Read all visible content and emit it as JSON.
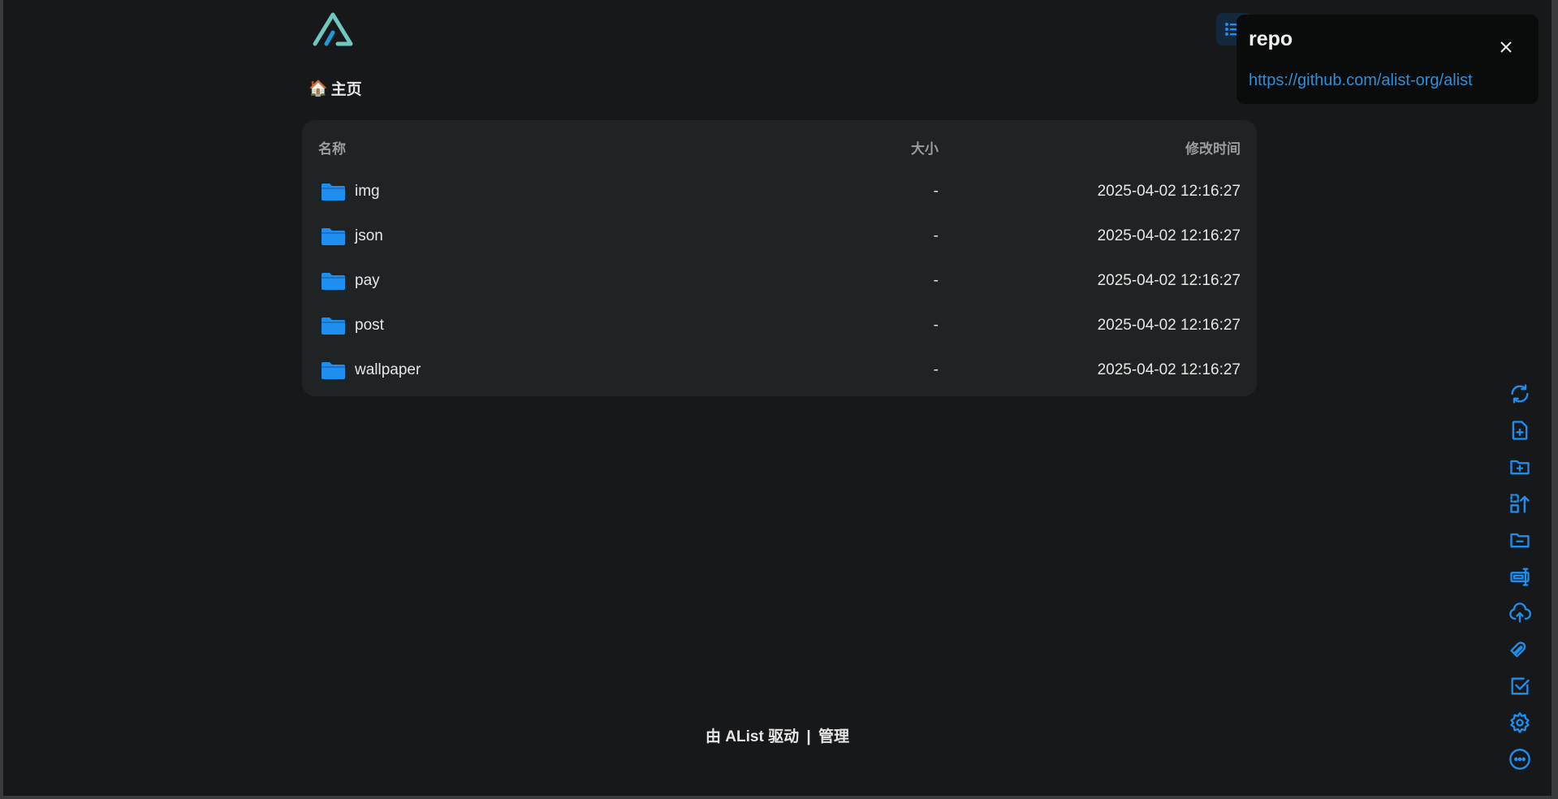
{
  "breadcrumb": {
    "icon": "🏠",
    "label": "主页"
  },
  "table": {
    "headers": {
      "name": "名称",
      "size": "大小",
      "modified": "修改时间"
    },
    "rows": [
      {
        "name": "img",
        "size": "-",
        "modified": "2025-04-02 12:16:27"
      },
      {
        "name": "json",
        "size": "-",
        "modified": "2025-04-02 12:16:27"
      },
      {
        "name": "pay",
        "size": "-",
        "modified": "2025-04-02 12:16:27"
      },
      {
        "name": "post",
        "size": "-",
        "modified": "2025-04-02 12:16:27"
      },
      {
        "name": "wallpaper",
        "size": "-",
        "modified": "2025-04-02 12:16:27"
      }
    ]
  },
  "popup": {
    "title": "repo",
    "link": "https://github.com/alist-org/alist"
  },
  "toolbar": [
    "refresh-icon",
    "new-file-icon",
    "new-folder-icon",
    "recursive-move-icon",
    "remove-empty-folder-icon",
    "batch-rename-icon",
    "upload-icon",
    "offline-download-icon",
    "toggle-checkbox-icon",
    "local-settings-icon",
    "more-icon"
  ],
  "footer": {
    "powered": "由 AList 驱动",
    "sep": "|",
    "manage": "管理"
  },
  "colors": {
    "accent": "#1e8ef0",
    "bg": "#17181a",
    "card": "#202324"
  }
}
